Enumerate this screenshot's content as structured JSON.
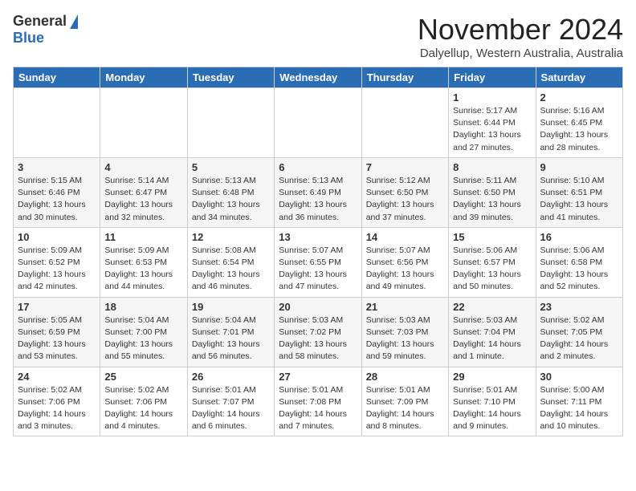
{
  "logo": {
    "general": "General",
    "blue": "Blue"
  },
  "title": "November 2024",
  "subtitle": "Dalyellup, Western Australia, Australia",
  "headers": [
    "Sunday",
    "Monday",
    "Tuesday",
    "Wednesday",
    "Thursday",
    "Friday",
    "Saturday"
  ],
  "weeks": [
    [
      {
        "day": "",
        "info": ""
      },
      {
        "day": "",
        "info": ""
      },
      {
        "day": "",
        "info": ""
      },
      {
        "day": "",
        "info": ""
      },
      {
        "day": "",
        "info": ""
      },
      {
        "day": "1",
        "info": "Sunrise: 5:17 AM\nSunset: 6:44 PM\nDaylight: 13 hours\nand 27 minutes."
      },
      {
        "day": "2",
        "info": "Sunrise: 5:16 AM\nSunset: 6:45 PM\nDaylight: 13 hours\nand 28 minutes."
      }
    ],
    [
      {
        "day": "3",
        "info": "Sunrise: 5:15 AM\nSunset: 6:46 PM\nDaylight: 13 hours\nand 30 minutes."
      },
      {
        "day": "4",
        "info": "Sunrise: 5:14 AM\nSunset: 6:47 PM\nDaylight: 13 hours\nand 32 minutes."
      },
      {
        "day": "5",
        "info": "Sunrise: 5:13 AM\nSunset: 6:48 PM\nDaylight: 13 hours\nand 34 minutes."
      },
      {
        "day": "6",
        "info": "Sunrise: 5:13 AM\nSunset: 6:49 PM\nDaylight: 13 hours\nand 36 minutes."
      },
      {
        "day": "7",
        "info": "Sunrise: 5:12 AM\nSunset: 6:50 PM\nDaylight: 13 hours\nand 37 minutes."
      },
      {
        "day": "8",
        "info": "Sunrise: 5:11 AM\nSunset: 6:50 PM\nDaylight: 13 hours\nand 39 minutes."
      },
      {
        "day": "9",
        "info": "Sunrise: 5:10 AM\nSunset: 6:51 PM\nDaylight: 13 hours\nand 41 minutes."
      }
    ],
    [
      {
        "day": "10",
        "info": "Sunrise: 5:09 AM\nSunset: 6:52 PM\nDaylight: 13 hours\nand 42 minutes."
      },
      {
        "day": "11",
        "info": "Sunrise: 5:09 AM\nSunset: 6:53 PM\nDaylight: 13 hours\nand 44 minutes."
      },
      {
        "day": "12",
        "info": "Sunrise: 5:08 AM\nSunset: 6:54 PM\nDaylight: 13 hours\nand 46 minutes."
      },
      {
        "day": "13",
        "info": "Sunrise: 5:07 AM\nSunset: 6:55 PM\nDaylight: 13 hours\nand 47 minutes."
      },
      {
        "day": "14",
        "info": "Sunrise: 5:07 AM\nSunset: 6:56 PM\nDaylight: 13 hours\nand 49 minutes."
      },
      {
        "day": "15",
        "info": "Sunrise: 5:06 AM\nSunset: 6:57 PM\nDaylight: 13 hours\nand 50 minutes."
      },
      {
        "day": "16",
        "info": "Sunrise: 5:06 AM\nSunset: 6:58 PM\nDaylight: 13 hours\nand 52 minutes."
      }
    ],
    [
      {
        "day": "17",
        "info": "Sunrise: 5:05 AM\nSunset: 6:59 PM\nDaylight: 13 hours\nand 53 minutes."
      },
      {
        "day": "18",
        "info": "Sunrise: 5:04 AM\nSunset: 7:00 PM\nDaylight: 13 hours\nand 55 minutes."
      },
      {
        "day": "19",
        "info": "Sunrise: 5:04 AM\nSunset: 7:01 PM\nDaylight: 13 hours\nand 56 minutes."
      },
      {
        "day": "20",
        "info": "Sunrise: 5:03 AM\nSunset: 7:02 PM\nDaylight: 13 hours\nand 58 minutes."
      },
      {
        "day": "21",
        "info": "Sunrise: 5:03 AM\nSunset: 7:03 PM\nDaylight: 13 hours\nand 59 minutes."
      },
      {
        "day": "22",
        "info": "Sunrise: 5:03 AM\nSunset: 7:04 PM\nDaylight: 14 hours\nand 1 minute."
      },
      {
        "day": "23",
        "info": "Sunrise: 5:02 AM\nSunset: 7:05 PM\nDaylight: 14 hours\nand 2 minutes."
      }
    ],
    [
      {
        "day": "24",
        "info": "Sunrise: 5:02 AM\nSunset: 7:06 PM\nDaylight: 14 hours\nand 3 minutes."
      },
      {
        "day": "25",
        "info": "Sunrise: 5:02 AM\nSunset: 7:06 PM\nDaylight: 14 hours\nand 4 minutes."
      },
      {
        "day": "26",
        "info": "Sunrise: 5:01 AM\nSunset: 7:07 PM\nDaylight: 14 hours\nand 6 minutes."
      },
      {
        "day": "27",
        "info": "Sunrise: 5:01 AM\nSunset: 7:08 PM\nDaylight: 14 hours\nand 7 minutes."
      },
      {
        "day": "28",
        "info": "Sunrise: 5:01 AM\nSunset: 7:09 PM\nDaylight: 14 hours\nand 8 minutes."
      },
      {
        "day": "29",
        "info": "Sunrise: 5:01 AM\nSunset: 7:10 PM\nDaylight: 14 hours\nand 9 minutes."
      },
      {
        "day": "30",
        "info": "Sunrise: 5:00 AM\nSunset: 7:11 PM\nDaylight: 14 hours\nand 10 minutes."
      }
    ]
  ]
}
